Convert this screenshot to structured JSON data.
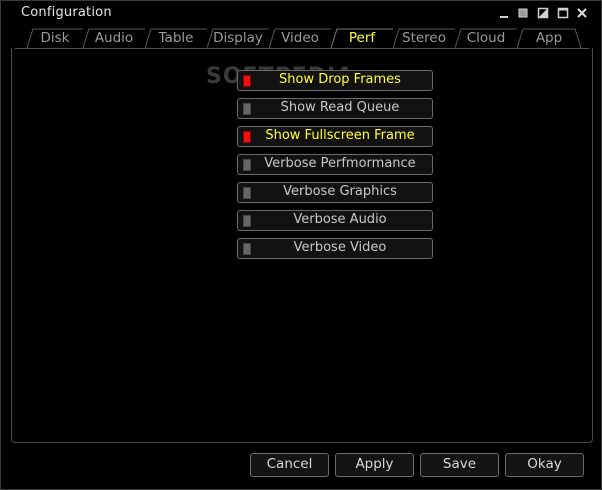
{
  "window": {
    "title": "Configuration",
    "controls": [
      "minimize-icon",
      "restore-icon",
      "maximize-icon",
      "maximize-icon",
      "close-icon"
    ]
  },
  "tabs": [
    {
      "label": "Disk",
      "active": false
    },
    {
      "label": "Audio",
      "active": false
    },
    {
      "label": "Table",
      "active": false
    },
    {
      "label": "Display",
      "active": false
    },
    {
      "label": "Video",
      "active": false
    },
    {
      "label": "Perf",
      "active": true
    },
    {
      "label": "Stereo",
      "active": false
    },
    {
      "label": "Cloud",
      "active": false
    },
    {
      "label": "App",
      "active": false
    }
  ],
  "options": [
    {
      "label": "Show Drop Frames",
      "on": true
    },
    {
      "label": "Show Read Queue",
      "on": false
    },
    {
      "label": "Show Fullscreen Frame",
      "on": true
    },
    {
      "label": "Verbose Perfmormance",
      "on": false
    },
    {
      "label": "Verbose Graphics",
      "on": false
    },
    {
      "label": "Verbose Audio",
      "on": false
    },
    {
      "label": "Verbose Video",
      "on": false
    }
  ],
  "watermark": "SOFTPEDIA",
  "buttons": {
    "cancel": "Cancel",
    "apply": "Apply",
    "save": "Save",
    "okay": "Okay"
  },
  "colors": {
    "active_text": "#ffff33",
    "led_on": "#ee1111",
    "led_off": "#666666",
    "background": "#000000"
  }
}
